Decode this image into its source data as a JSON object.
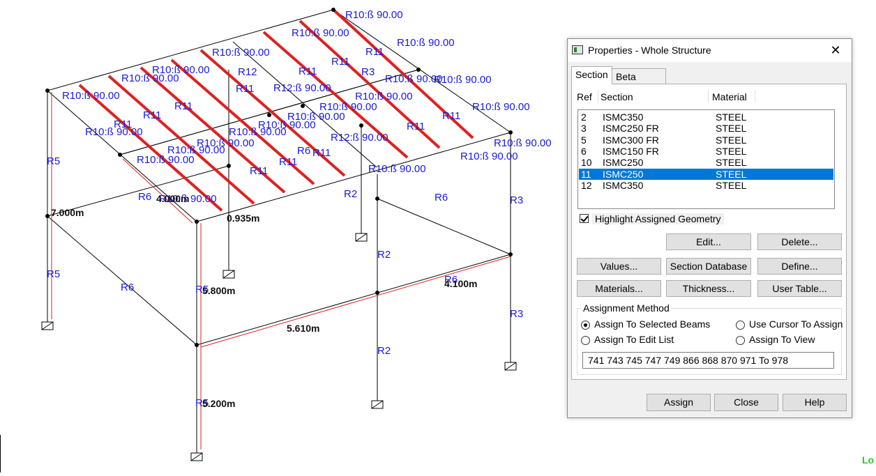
{
  "viewport": {
    "labels_blue": [
      "R10:ß 90.00",
      "R10:ß 90.00",
      "R10:ß 90.00",
      "R10:ß 90.00",
      "R10:ß 90.00",
      "R10:ß 90.00",
      "R10:ß 90.00",
      "R10:ß 90.00",
      "R10:ß 90.00",
      "R10:ß 90.00",
      "R10:ß 90.00",
      "R10:ß 90.00",
      "R10:ß 90.00",
      "R10:ß 90.00",
      "R10:ß 90.00",
      "R10:ß 90.00",
      "R10:ß 90.00",
      "R10:ß 90.00",
      "R10:ß 90.00",
      "R10:ß 90.00",
      "R11",
      "R11",
      "R11",
      "R11",
      "R11",
      "R11",
      "R11",
      "R11",
      "R11",
      "R11",
      "R11",
      "R11",
      "R12",
      "R12:ß 90.00",
      "R12:ß 90.00",
      "R3",
      "R3",
      "R3",
      "R5",
      "R5",
      "R5",
      "R5",
      "R6",
      "R6",
      "R6",
      "R6",
      "R6",
      "R2",
      "R2",
      "R2",
      "R10:ß 90.00",
      "R10:ß 90.00",
      "R10:ß 90.00"
    ],
    "labels_dim": [
      "7.000m",
      "4.000m",
      "0.935m",
      "5.800m",
      "5.610m",
      "4.100m",
      "5.200m"
    ],
    "support_icon": "fixed-support-icon"
  },
  "dialog": {
    "title": "Properties - Whole Structure",
    "close_icon": "close-icon",
    "tabs": [
      "Section",
      "Beta Angle"
    ],
    "columns": {
      "ref": "Ref",
      "section": "Section",
      "material": "Material"
    },
    "rows": [
      {
        "ref": "2",
        "section": "ISMC350",
        "material": "STEEL"
      },
      {
        "ref": "3",
        "section": "ISMC250 FR",
        "material": "STEEL"
      },
      {
        "ref": "5",
        "section": "ISMC300 FR",
        "material": "STEEL"
      },
      {
        "ref": "6",
        "section": "ISMC150 FR",
        "material": "STEEL"
      },
      {
        "ref": "10",
        "section": "ISMC250",
        "material": "STEEL"
      },
      {
        "ref": "11",
        "section": "ISMC250",
        "material": "STEEL"
      },
      {
        "ref": "12",
        "section": "ISMC350",
        "material": "STEEL"
      }
    ],
    "selected_row": 5,
    "highlight_label": "Highlight Assigned Geometry",
    "highlight_checked": true,
    "buttons": {
      "edit": "Edit...",
      "delete": "Delete...",
      "values": "Values...",
      "section_db": "Section Database",
      "define": "Define...",
      "materials": "Materials...",
      "thickness": "Thickness...",
      "user_table": "User Table..."
    },
    "assignment": {
      "group_label": "Assignment Method",
      "opt_selected_beams": "Assign To Selected Beams",
      "opt_cursor": "Use Cursor To Assign",
      "opt_edit_list": "Assign To Edit List",
      "opt_view": "Assign To View",
      "selected_option": "Assign To Selected Beams",
      "list_value": "741 743 745 747 749 866 868 870 971 To 978"
    },
    "footer": {
      "assign": "Assign",
      "close": "Close",
      "help": "Help"
    }
  },
  "status_text": "Lo",
  "colors": {
    "highlight": "#e02020",
    "label": "#1a1ad6",
    "selection": "#0078d7"
  }
}
